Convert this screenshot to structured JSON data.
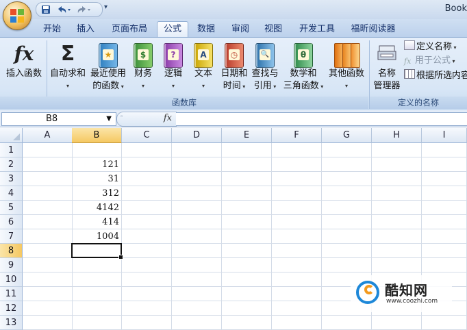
{
  "window": {
    "title": "Book"
  },
  "quick_access": {
    "save": "save-icon",
    "undo": "undo-icon",
    "redo": "redo-icon",
    "more": "▾"
  },
  "tabs": [
    {
      "label": "开始"
    },
    {
      "label": "插入"
    },
    {
      "label": "页面布局"
    },
    {
      "label": "公式",
      "active": true
    },
    {
      "label": "数据"
    },
    {
      "label": "审阅"
    },
    {
      "label": "视图"
    },
    {
      "label": "开发工具"
    },
    {
      "label": "福昕阅读器"
    }
  ],
  "ribbon": {
    "insert_function": {
      "label": "插入函数",
      "icon": "fx"
    },
    "autosum": {
      "line1": "自动求和",
      "icon": "Σ"
    },
    "recent": {
      "line1": "最近使用",
      "line2": "的函数"
    },
    "financial": {
      "line1": "财务"
    },
    "logical": {
      "line1": "逻辑"
    },
    "text": {
      "line1": "文本"
    },
    "datetime": {
      "line1": "日期和",
      "line2": "时间"
    },
    "lookup": {
      "line1": "查找与",
      "line2": "引用"
    },
    "math": {
      "line1": "数学和",
      "line2": "三角函数"
    },
    "more": {
      "line1": "其他函数"
    },
    "name_manager": {
      "line1": "名称",
      "line2": "管理器"
    },
    "define_name": "定义名称",
    "use_in_formula": "用于公式",
    "create_from_selection": "根据所选内容",
    "group_library": "函数库",
    "group_names": "定义的名称",
    "book_glyphs": {
      "recent": "★",
      "financial": "$",
      "logical": "?",
      "text": "A",
      "datetime": "◷",
      "lookup": "🔍",
      "math": "θ"
    }
  },
  "formula_bar": {
    "name_box": "B8",
    "fx": "fx",
    "formula": ""
  },
  "sheet": {
    "columns": [
      "A",
      "B",
      "C",
      "D",
      "E",
      "F",
      "G",
      "H",
      "I"
    ],
    "rows": [
      "1",
      "2",
      "3",
      "4",
      "5",
      "6",
      "7",
      "8",
      "9",
      "10",
      "11",
      "12",
      "13"
    ],
    "selected_column": "B",
    "selected_row": "8",
    "values": {
      "B2": "121",
      "B3": "31",
      "B4": "312",
      "B5": "4142",
      "B6": "414",
      "B7": "1004"
    }
  },
  "watermark": {
    "name": "酷知网",
    "url": "www.coozhi.com"
  },
  "colors": {
    "accent": "#f5c862",
    "ribbon": "#dbe7f6",
    "header_blue": "#15306a"
  }
}
